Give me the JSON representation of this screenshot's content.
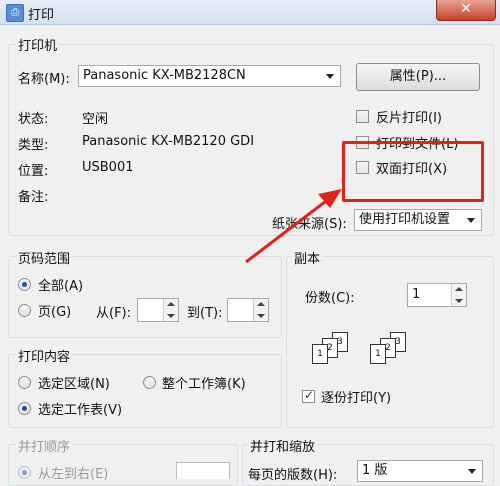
{
  "window": {
    "title": "打印",
    "close_symbol": "✕",
    "app_icon": "printer-icon"
  },
  "printer": {
    "legend": "打印机",
    "name_label": "名称(M):",
    "name_value": "Panasonic KX-MB2128CN",
    "properties_button": "属性(P)...",
    "status_label": "状态:",
    "status_value": "空闲",
    "type_label": "类型:",
    "type_value": "Panasonic KX-MB2120 GDI",
    "location_label": "位置:",
    "location_value": "USB001",
    "comment_label": "备注:",
    "reverse_print": "反片打印(I)",
    "print_to_file": "打印到文件(L)",
    "duplex": "双面打印(X)",
    "paper_source_label": "纸张来源(S):",
    "paper_source_value": "使用打印机设置"
  },
  "page_range": {
    "legend": "页码范围",
    "all": "全部(A)",
    "pages": "页(G)",
    "from_label": "从(F):",
    "to_label": "到(T):"
  },
  "copies": {
    "legend": "副本",
    "count_label": "份数(C):",
    "count_value": "1",
    "collate": "逐份打印(Y)",
    "icon": "collate-pages-icon",
    "sheet_numbers": [
      "1",
      "2",
      "3"
    ]
  },
  "print_content": {
    "legend": "打印内容",
    "selection": "选定区域(N)",
    "workbook": "整个工作簿(K)",
    "worksheet": "选定工作表(V)"
  },
  "collate_order": {
    "legend": "并打顺序",
    "left_to_right": "从左到右(E)"
  },
  "scaling": {
    "legend": "并打和缩放",
    "pages_per_sheet_label": "每页的版数(H):",
    "pages_per_sheet_value": "1 版"
  },
  "annotation": {
    "color": "#e0221d"
  }
}
